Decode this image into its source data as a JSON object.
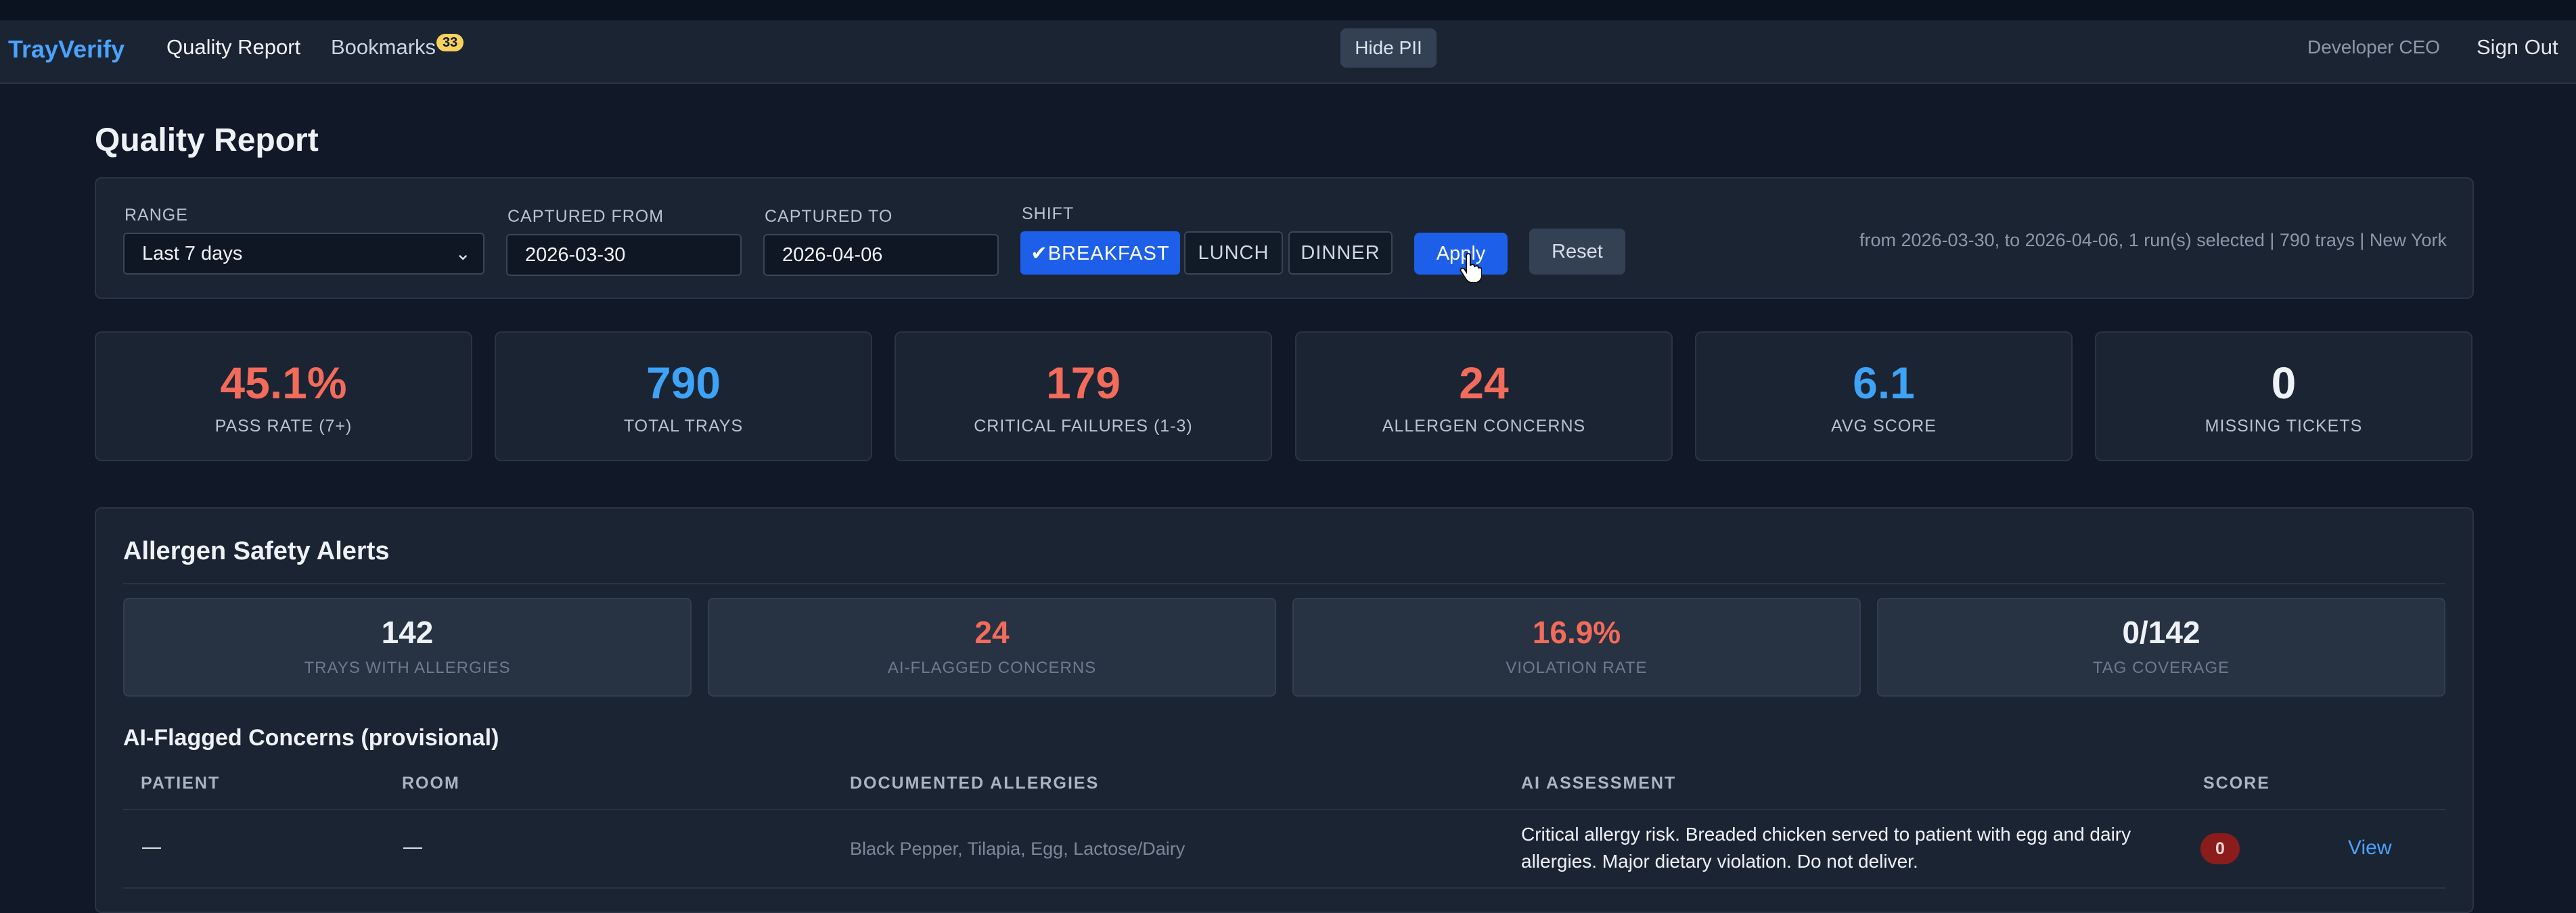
{
  "nav": {
    "brand": "TrayVerify",
    "links": [
      "Quality Report",
      "Bookmarks"
    ],
    "bookmarks_count": "33",
    "hide_pii": "Hide PII",
    "user": "Developer CEO",
    "sign_out": "Sign Out"
  },
  "page": {
    "title": "Quality Report"
  },
  "filters": {
    "range_label": "RANGE",
    "range_value": "Last 7 days",
    "from_label": "CAPTURED FROM",
    "from_value": "2026-03-30",
    "to_label": "CAPTURED TO",
    "to_value": "2026-04-06",
    "shift_label": "SHIFT",
    "shifts": [
      "✔BREAKFAST",
      "LUNCH",
      "DINNER"
    ],
    "selected_shift": "BREAKFAST",
    "apply": "Apply",
    "reset": "Reset",
    "summary": "from 2026-03-30, to 2026-04-06, 1 run(s) selected | 790 trays | New York"
  },
  "stats": [
    {
      "value": "45.1%",
      "label": "PASS RATE (7+)",
      "color": "#f26b5b"
    },
    {
      "value": "790",
      "label": "TOTAL TRAYS",
      "color": "#3ea3f6"
    },
    {
      "value": "179",
      "label": "CRITICAL FAILURES (1-3)",
      "color": "#f26b5b"
    },
    {
      "value": "24",
      "label": "ALLERGEN CONCERNS",
      "color": "#f26b5b"
    },
    {
      "value": "6.1",
      "label": "AVG SCORE",
      "color": "#3ea3f6"
    },
    {
      "value": "0",
      "label": "MISSING TICKETS",
      "color": "#eef2f7"
    }
  ],
  "allergen": {
    "title": "Allergen Safety Alerts",
    "cards": [
      {
        "value": "142",
        "label": "TRAYS WITH ALLERGIES",
        "color": "#eef2f7"
      },
      {
        "value": "24",
        "label": "AI-FLAGGED CONCERNS",
        "color": "#f26b5b"
      },
      {
        "value": "16.9%",
        "label": "VIOLATION RATE",
        "color": "#f26b5b"
      },
      {
        "value": "0/142",
        "label": "TAG COVERAGE",
        "color": "#eef2f7"
      }
    ],
    "subtitle": "AI-Flagged Concerns (provisional)",
    "columns": [
      "PATIENT",
      "ROOM",
      "DOCUMENTED ALLERGIES",
      "AI ASSESSMENT",
      "SCORE"
    ],
    "rows": [
      {
        "patient": "—",
        "room": "—",
        "allergies": "Black Pepper, Tilapia, Egg, Lactose/Dairy",
        "assessment_line1": "Critical allergy risk. Breaded chicken served to patient with egg and dairy",
        "assessment_line2": "allergies. Major dietary violation. Do not deliver.",
        "score": "0",
        "action": "View"
      }
    ]
  },
  "colors": {
    "accent": "#1d5fe8",
    "danger": "#f26b5b",
    "info": "#3ea3f6"
  }
}
